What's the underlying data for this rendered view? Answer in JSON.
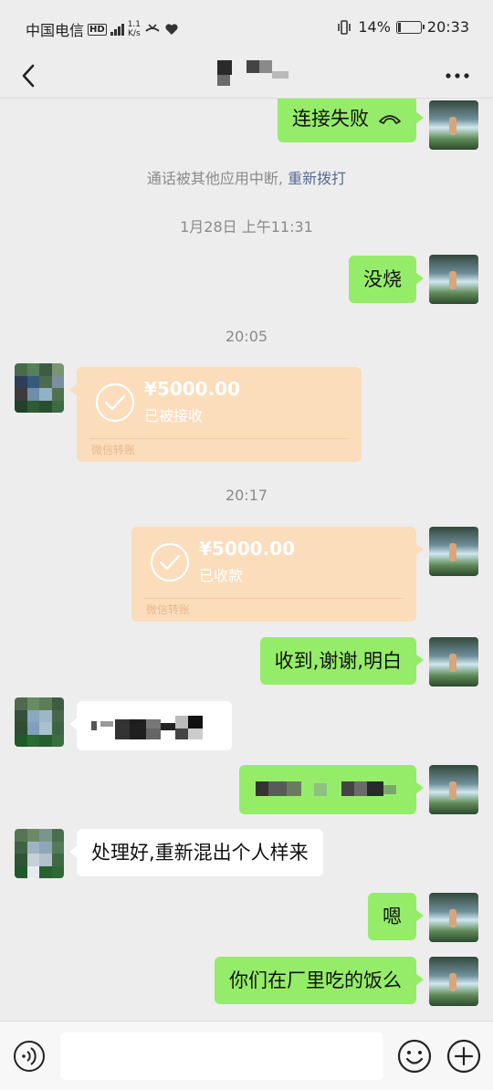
{
  "status_bar": {
    "carrier": "中国电信",
    "hd": "HD",
    "net_speed_value": "1.1",
    "net_speed_unit": "K/s",
    "battery_percent": "14%",
    "time": "20:33"
  },
  "messages": {
    "call_failed": "连接失败",
    "call_interrupted": "通话被其他应用中断,",
    "redial": "重新拨打",
    "timestamp_1": "1月28日 上午11:31",
    "msg_mei_shao": "没烧",
    "timestamp_2": "20:05",
    "transfer_1": {
      "amount": "¥5000.00",
      "status": "已被接收",
      "footer": "微信转账"
    },
    "timestamp_3": "20:17",
    "transfer_2": {
      "amount": "¥5000.00",
      "status": "已收款",
      "footer": "微信转账"
    },
    "msg_received": "收到,谢谢,明白",
    "msg_handle": "处理好,重新混出个人样来",
    "msg_en": "嗯",
    "msg_factory": "你们在厂里吃的饭么"
  },
  "colors": {
    "my_bubble": "#95ec69",
    "other_bubble": "#ffffff",
    "transfer_bg": "#fbdcbb",
    "link": "#576b95",
    "background": "#ededed"
  },
  "icons": [
    "back-icon",
    "more-icon",
    "hangup-icon",
    "check-icon",
    "voice-icon",
    "emoji-icon",
    "plus-icon"
  ]
}
